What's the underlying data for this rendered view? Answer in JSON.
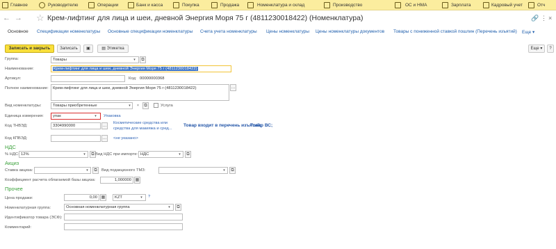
{
  "top_menu": [
    {
      "label": "Главное",
      "icon": "menu-icon"
    },
    {
      "label": "Руководителю",
      "icon": "chart-icon"
    },
    {
      "label": "Операции",
      "icon": "operations-icon"
    },
    {
      "label": "Банк и касса",
      "icon": "bank-icon"
    },
    {
      "label": "Покупка",
      "icon": "cart-icon"
    },
    {
      "label": "Продажа",
      "icon": "sale-icon"
    },
    {
      "label": "Номенклатура и склад",
      "icon": "warehouse-icon"
    },
    {
      "label": "Производство",
      "icon": "factory-icon"
    },
    {
      "label": "ОС и НМА",
      "icon": "assets-icon"
    },
    {
      "label": "Зарплата",
      "icon": "salary-icon"
    },
    {
      "label": "Кадровый учет",
      "icon": "people-icon"
    },
    {
      "label": "Отч",
      "icon": "reports-icon"
    }
  ],
  "header": {
    "title": "Крем-лифтинг для лица и шеи, дневной Энергия Моря 75 г (4811230018422) (Номенклатура)",
    "back": "←",
    "forward": "→",
    "star": "☆",
    "link_icon": "🔗",
    "more": "⋮",
    "close": "×"
  },
  "tabs": [
    "Основное",
    "Спецификации номенклатуры",
    "Основные спецификации номенклатуры",
    "Счета учета номенклатуры",
    "Цены номенклатуры",
    "Цены номенклатуры документов",
    "Товары с пониженной ставкой пошлин (Перечень изъятий)",
    "Еще"
  ],
  "toolbar": {
    "save_close": "Записать и закрыть",
    "save": "Записать",
    "label": "Этикетка",
    "more": "Еще",
    "help": "?"
  },
  "form": {
    "group_label": "Группа:",
    "group_value": "Товары",
    "name_label": "Наименование:",
    "name_value": "Крем-лифтинг для лица и шеи, дневной Энергия Моря 75 г (4811230018422)",
    "article_label": "Артикул:",
    "article_value": "",
    "code_label": "Код:",
    "code_value": "00000000368",
    "fullname_label": "Полное наименование:",
    "fullname_value": "Крем-лифтинг для лица и шеи, дневной Энергия Моря 75 г (4811230018422)",
    "type_label": "Вид номенклатуры:",
    "type_value": "Товары приобретенные",
    "service_label": "Услуга",
    "unit_label": "Единица измерения:",
    "unit_value": "упак",
    "unit_link": "Упаковка",
    "tnved_label": "Код ТНВЭД:",
    "tnved_value": "3304990000",
    "tnved_desc_1": "Косметические средства или",
    "tnved_desc_2": "средства для макияжа и сред...",
    "withdrawal_note": "Товар входит в перечень изъятий;",
    "vs_note": "Товар ВС;",
    "kpved_label": "Код КПВЭД:",
    "kpved_value": "",
    "kpved_link": "<не указано>",
    "vat_section": "НДС",
    "vat_rate_label": "% НДС:",
    "vat_rate_value": "12%",
    "vat_import_label": "Вид НДС при импорте:",
    "vat_import_value": "НДС",
    "excise_section": "Акциз",
    "excise_rate_label": "Ставка акциза:",
    "excise_rate_value": "",
    "excise_type_label": "Вид подакцизного ТМЗ:",
    "excise_type_value": "",
    "coef_label": "Коэффициент расчета облагаемой базы акциза:",
    "coef_value": "1,000000",
    "other_section": "Прочее",
    "price_label": "Цена продажи:",
    "price_value": "0,00",
    "currency_value": "KZT",
    "price_help": "?",
    "nom_group_label": "Номенклатурная группа:",
    "nom_group_value": "Основная номенклатурная группа",
    "esf_label": "Идентификатор товара (ЭСФ):",
    "esf_value": "",
    "comment_label": "Комментарий:",
    "comment_value": ""
  }
}
